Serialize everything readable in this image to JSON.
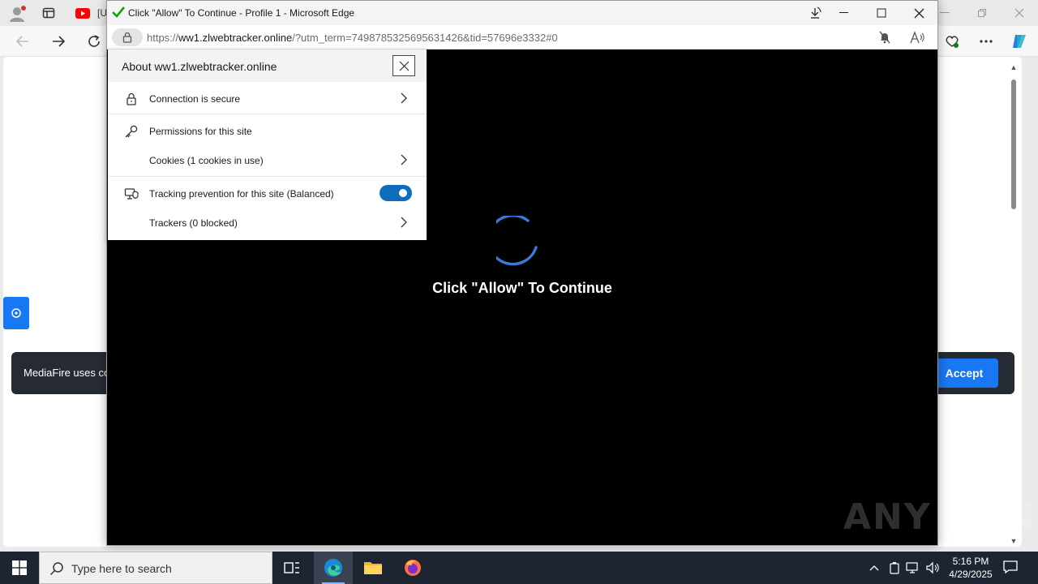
{
  "background_browser": {
    "partial_tab_text": "[U",
    "page": {
      "banner_text": "MediaFire uses co",
      "accept_label": "Accept"
    }
  },
  "popup": {
    "title": "Click \"Allow\" To Continue - Profile 1 - Microsoft Edge",
    "url": {
      "scheme": "https://",
      "host": "ww1.zlwebtracker.online",
      "rest": "/?utm_term=7498785325695631426&tid=57696e3332#0"
    },
    "content": {
      "message": "Click \"Allow\" To Continue"
    },
    "site_info": {
      "title": "About ww1.zlwebtracker.online",
      "rows": [
        {
          "label": "Connection is secure",
          "icon": "lock-icon"
        },
        {
          "label": "Permissions for this site",
          "icon": "key-icon"
        },
        {
          "label": "Cookies (1 cookies in use)",
          "icon": ""
        },
        {
          "label": "Tracking prevention for this site (Balanced)",
          "icon": "tracking-icon",
          "toggle_on": true
        },
        {
          "label": "Trackers (0 blocked)",
          "icon": ""
        }
      ]
    }
  },
  "watermark": "ANY RUN",
  "taskbar": {
    "search_placeholder": "Type here to search",
    "time": "5:16 PM",
    "date": "4/29/2025"
  },
  "colors": {
    "accent_blue": "#1877f2",
    "toggle_blue": "#0f6cbd",
    "taskbar": "#1e2532",
    "banner": "#262a33"
  }
}
